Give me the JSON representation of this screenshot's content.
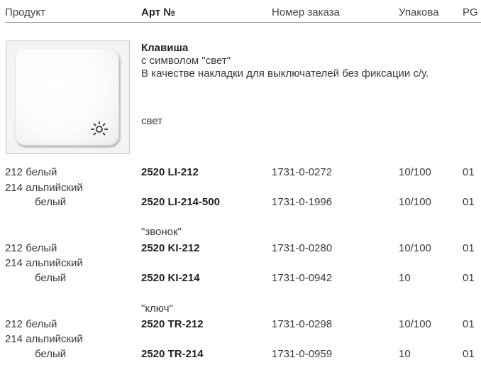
{
  "header": {
    "product": "Продукт",
    "art_no": "Арт №",
    "order_no": "Номер заказа",
    "pack": "Упакова",
    "pg": "PG"
  },
  "product": {
    "title": "Клавиша",
    "subtitle": "с символом \"свет\"",
    "description": "В качестве накладки для выключателей без фиксации с/у.",
    "symbol_label": "свет",
    "image_icon": "light-symbol-icon"
  },
  "groups": [
    {
      "label": "",
      "rows": [
        {
          "color": "212 белый",
          "art": "2520 LI-212",
          "order": "1731-0-0272",
          "pack": "10/100",
          "pg": "01"
        },
        {
          "color_line1": "214 альпийский",
          "color_line2": "белый",
          "art": "2520 LI-214-500",
          "order": "1731-0-1996",
          "pack": "10/100",
          "pg": "01"
        }
      ]
    },
    {
      "label": "\"звонок\"",
      "rows": [
        {
          "color": "212 белый",
          "art": "2520 KI-212",
          "order": "1731-0-0280",
          "pack": "10/100",
          "pg": "01"
        },
        {
          "color_line1": "214 альпийский",
          "color_line2": "белый",
          "art": "2520 KI-214",
          "order": "1731-0-0942",
          "pack": "10",
          "pg": "01"
        }
      ]
    },
    {
      "label": "\"ключ\"",
      "rows": [
        {
          "color": "212 белый",
          "art": "2520 TR-212",
          "order": "1731-0-0298",
          "pack": "10/100",
          "pg": "01"
        },
        {
          "color_line1": "214 альпийский",
          "color_line2": "белый",
          "art": "2520 TR-214",
          "order": "1731-0-0959",
          "pack": "10",
          "pg": "01"
        }
      ]
    }
  ]
}
